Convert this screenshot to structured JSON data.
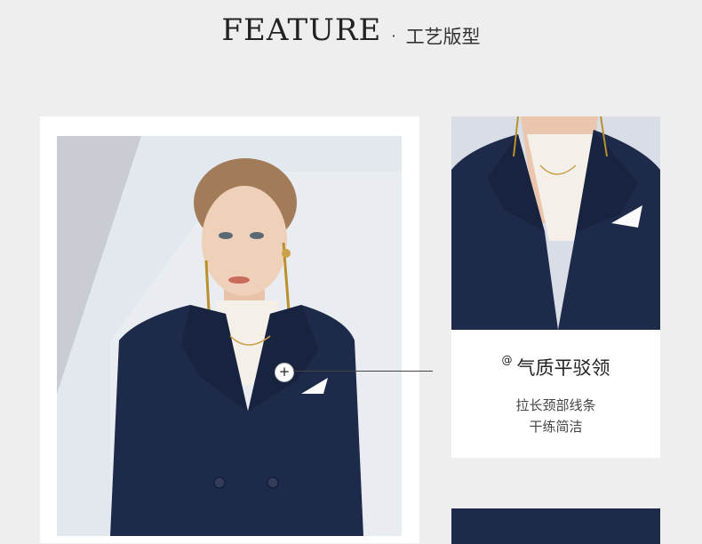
{
  "header": {
    "title_en": "FEATURE",
    "separator": "·",
    "title_cn": "工艺版型"
  },
  "callout": {
    "marker": "+",
    "at_symbol": "@",
    "title": "气质平驳领",
    "desc_line1": "拉长颈部线条",
    "desc_line2": "干练简洁"
  },
  "colors": {
    "background": "#eeeeee",
    "suit_navy": "#1e2a4a",
    "card_white": "#ffffff"
  }
}
